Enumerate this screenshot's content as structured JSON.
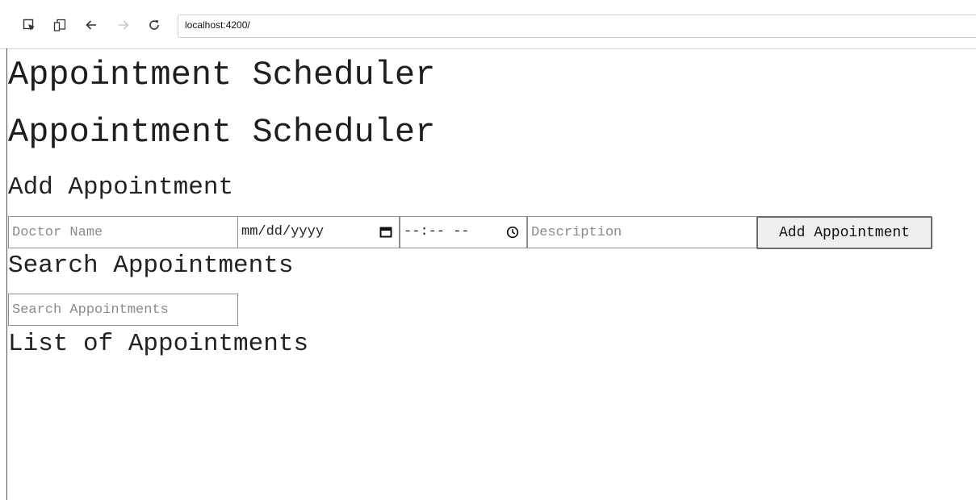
{
  "browser": {
    "url": "localhost:4200/"
  },
  "page": {
    "title": "Appointment Scheduler",
    "app_title": "Appointment Scheduler",
    "add_section_heading": "Add Appointment",
    "search_section_heading": "Search Appointments",
    "list_section_heading": "List of Appointments"
  },
  "add_form": {
    "doctor_name_placeholder": "Doctor Name",
    "date_value": "mm/dd/yyyy",
    "time_value": "--:-- --",
    "description_placeholder": "Description",
    "submit_label": "Add Appointment"
  },
  "search": {
    "placeholder": "Search Appointments"
  },
  "appointments": []
}
